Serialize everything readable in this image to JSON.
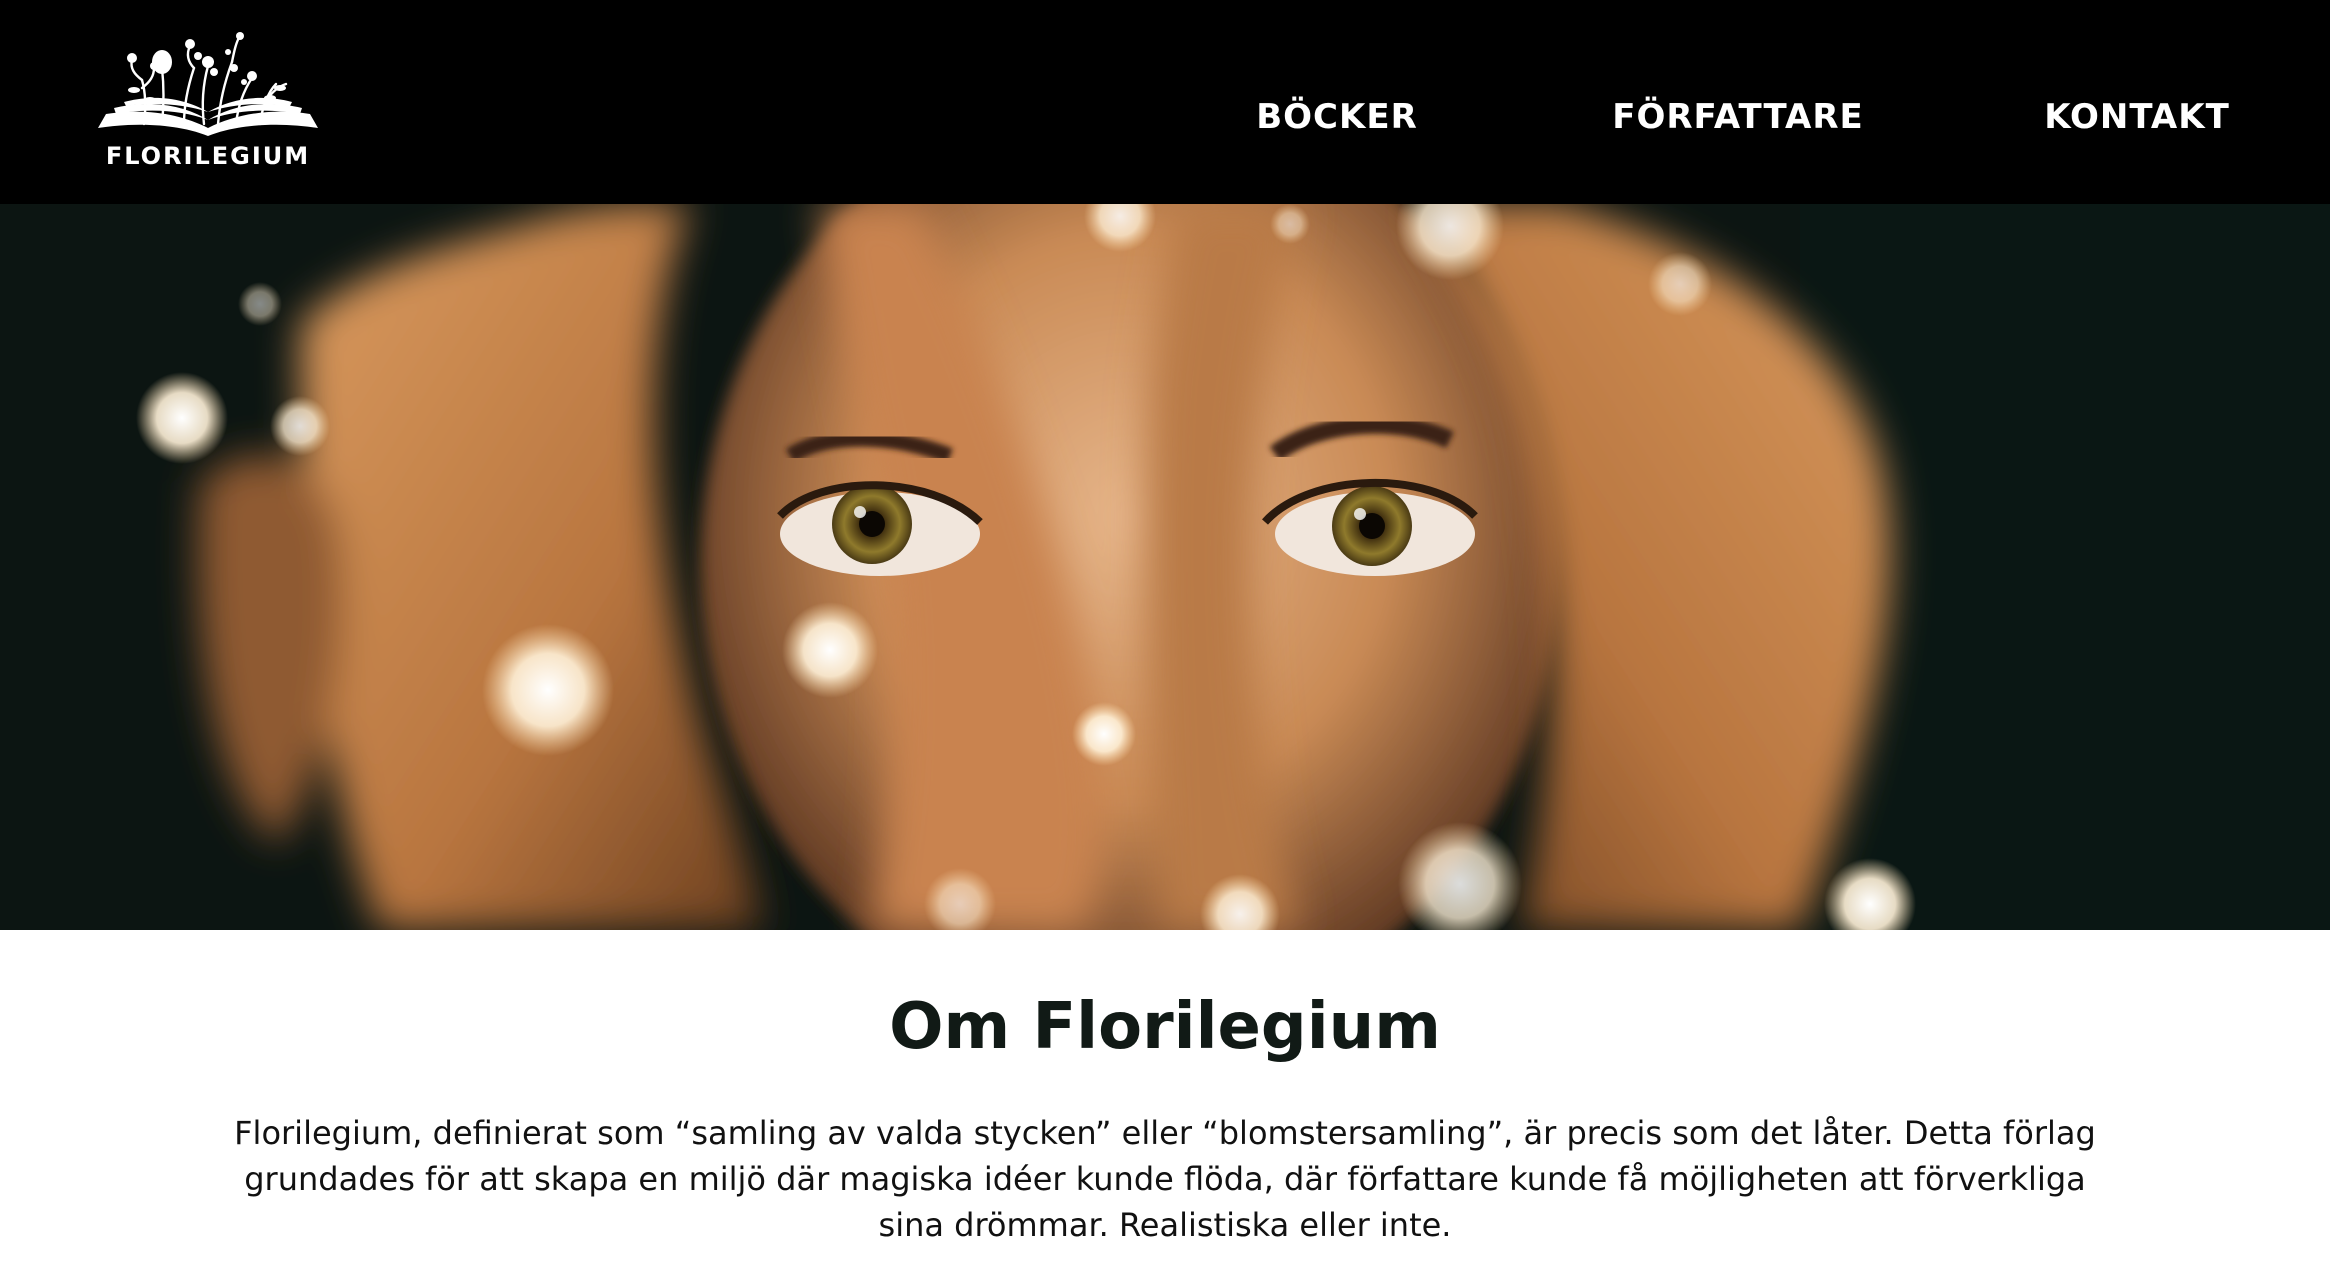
{
  "header": {
    "logo_text": "FLORILEGIUM",
    "logo_icon": "open-book-with-flowers-icon",
    "nav": [
      {
        "label": "BÖCKER"
      },
      {
        "label": "FÖRFATTARE"
      },
      {
        "label": "KONTAKT"
      }
    ]
  },
  "hero": {
    "image_subject": "face framed by hands with bokeh lights"
  },
  "about": {
    "title": "Om Florilegium",
    "body": "Florilegium, definierat som “samling av valda stycken” eller “blomstersamling”, är precis som det låter. Detta förlag grundades för att skapa en miljö där magiska idéer kunde flöda, där författare kunde få möjligheten att förverkliga sina drömmar. Realistiska eller inte."
  },
  "colors": {
    "header_bg": "#000000",
    "nav_text": "#ffffff",
    "title_text": "#111a16",
    "body_text": "#111111",
    "hero_dark": "#0c1512",
    "hero_skin": "#c98a55"
  }
}
